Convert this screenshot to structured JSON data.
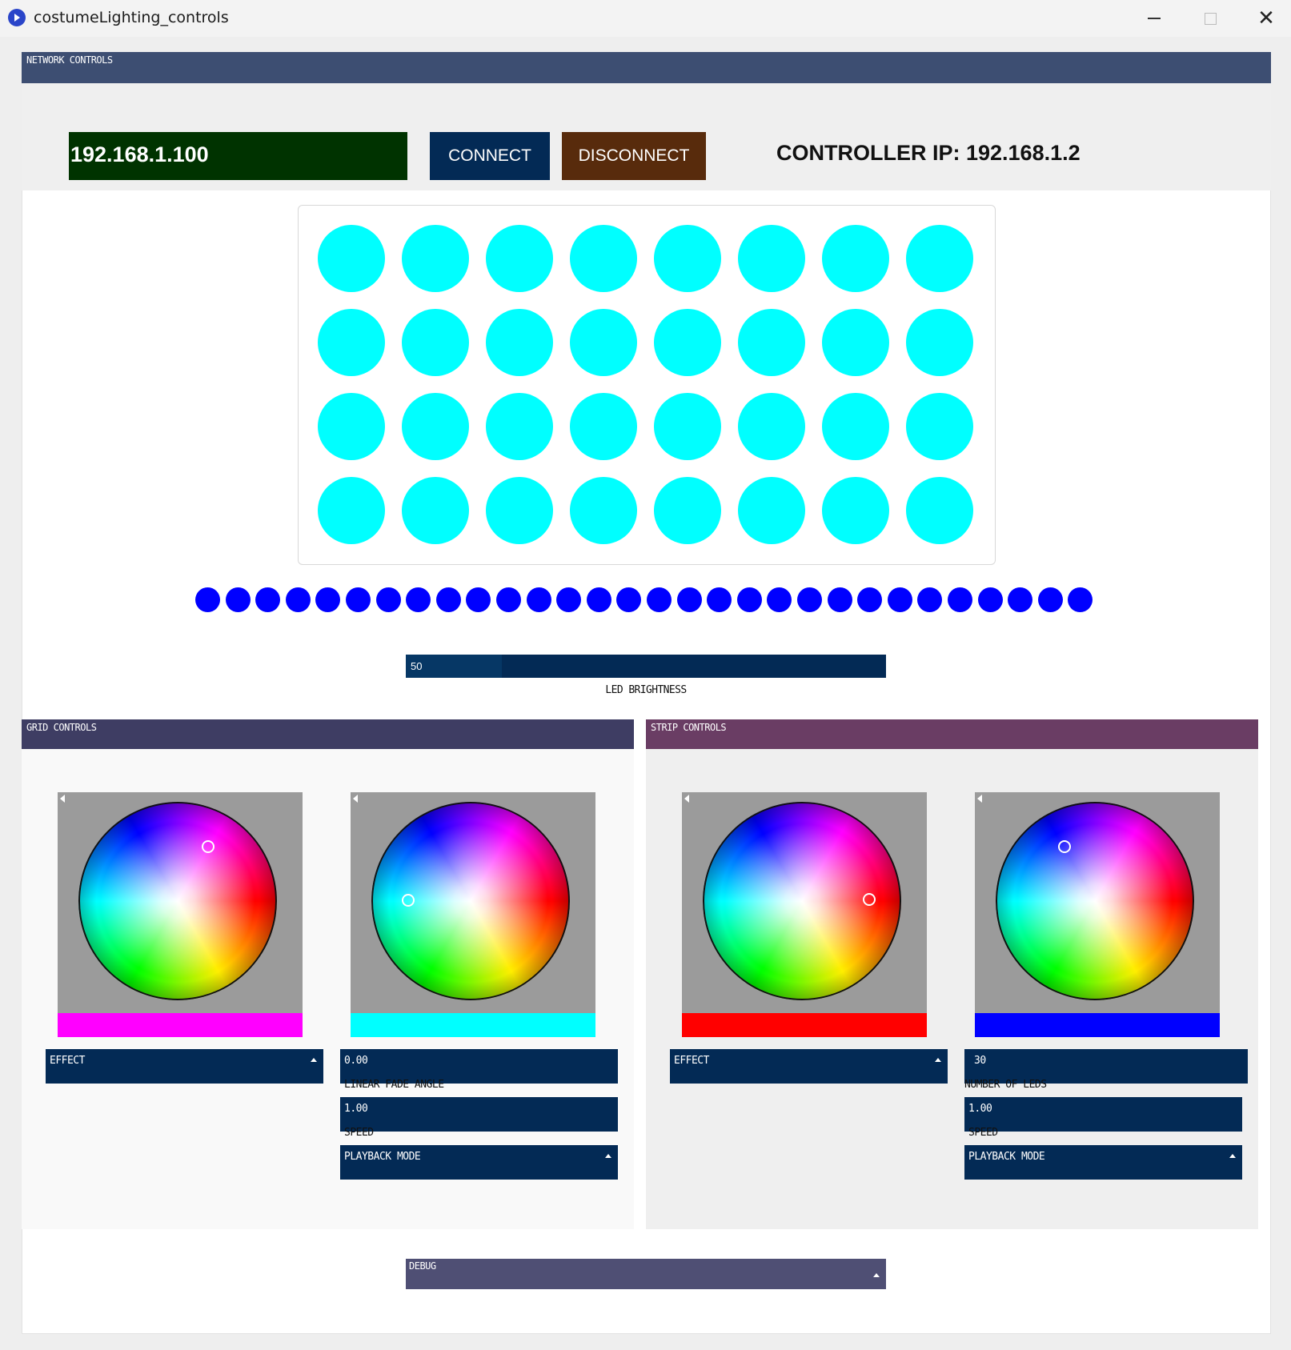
{
  "window": {
    "title": "costumeLighting_controls"
  },
  "network": {
    "panel_title": "NETWORK CONTROLS",
    "ip_input_value": "192.168.1.100",
    "connect_label": "CONNECT",
    "disconnect_label": "DISCONNECT",
    "controller_ip_text": "CONTROLLER IP: 192.168.1.2"
  },
  "preview": {
    "grid_rows": 4,
    "grid_cols": 8,
    "grid_color": "#00ffff",
    "strip_count": 30,
    "strip_color": "#0000ff"
  },
  "brightness": {
    "value": "50",
    "fraction": 0.2,
    "label": "LED BRIGHTNESS"
  },
  "grid_controls": {
    "panel_title": "GRID CONTROLS",
    "color1": "#ff00ff",
    "color2": "#00ffff",
    "effect_label": "EFFECT",
    "angle_value": "0.00",
    "angle_label": "LINEAR FADE ANGLE",
    "speed_value": "1.00",
    "speed_label": "SPEED",
    "playback_label": "PLAYBACK MODE"
  },
  "strip_controls": {
    "panel_title": "STRIP CONTROLS",
    "color1": "#ff0000",
    "color2": "#0000ff",
    "effect_label": "EFFECT",
    "num_leds_value": "30",
    "num_leds_label": "NUMBER OF LEDS",
    "speed_value": "1.00",
    "speed_label": "SPEED",
    "playback_label": "PLAYBACK MODE"
  },
  "debug": {
    "label": "DEBUG"
  }
}
